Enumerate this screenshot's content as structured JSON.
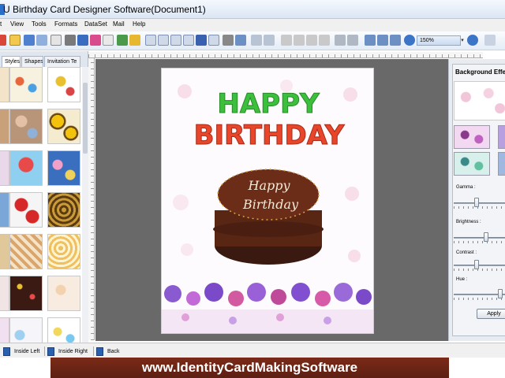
{
  "window": {
    "title": "U Birthday Card Designer Software(Document1)"
  },
  "menu": [
    "t",
    "View",
    "Tools",
    "Formats",
    "DataSet",
    "Mail",
    "Help"
  ],
  "toolbar": {
    "zoom_value": "150%"
  },
  "left_panel": {
    "tabs": [
      "Styles",
      "Shapes",
      "Invitation Te"
    ]
  },
  "card": {
    "headline_top": "HAPPY",
    "headline_bottom": "BIRTHDAY",
    "cake_line1": "Happy",
    "cake_line2": "Birthday",
    "headline_colors": [
      "#3cbf3c",
      "#e8462a",
      "#3a7fd8",
      "#f2a21e",
      "#b84ad6"
    ]
  },
  "right_panel": {
    "title": "Background Effe",
    "labels": {
      "gamma": "Gamma :",
      "brightness": "Brightness :",
      "contrast": "Contrast :",
      "hue": "Hue :"
    },
    "apply_label": "Apply"
  },
  "slider_values": {
    "gamma": 0.4,
    "brightness": 0.6,
    "contrast": 0.4,
    "hue": 0.88
  },
  "pages": [
    "Inside Left",
    "Inside Right",
    "Back"
  ],
  "footer": {
    "url": "www.IdentityCardMakingSoftware"
  },
  "colors": {
    "accent": "#2a6fc9",
    "footer_band": "#6a2415",
    "workspace": "#696969"
  }
}
